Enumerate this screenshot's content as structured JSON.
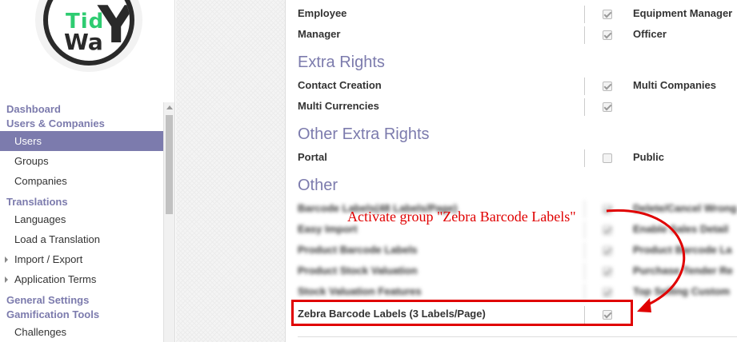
{
  "logo": {
    "text_top": "Tid",
    "text_bottom": "Wa",
    "letter": "Y"
  },
  "sidebar": {
    "sections": [
      {
        "header": "Dashboard"
      },
      {
        "header": "Users & Companies",
        "items": [
          "Users",
          "Groups",
          "Companies"
        ],
        "active": "Users"
      },
      {
        "header": "Translations",
        "items": [
          "Languages",
          "Load a Translation",
          "Import / Export",
          "Application Terms"
        ]
      },
      {
        "header": "General Settings"
      },
      {
        "header": "Gamification Tools",
        "items": [
          "Challenges"
        ]
      }
    ]
  },
  "rights": {
    "rows": [
      {
        "left": "Employee",
        "left_checked": true,
        "right": "Equipment Manager"
      },
      {
        "left": "Manager",
        "left_checked": true,
        "right": "Officer"
      }
    ],
    "extra_title": "Extra Rights",
    "extra_rows": [
      {
        "left": "Contact Creation",
        "left_checked": true,
        "right": "Multi Companies"
      },
      {
        "left": "Multi Currencies",
        "left_checked": true,
        "right": ""
      }
    ],
    "other_extra_title": "Other Extra Rights",
    "other_extra_rows": [
      {
        "left": "Portal",
        "left_checked": false,
        "right": "Public"
      }
    ],
    "other_title": "Other",
    "other_blurred_rows": [
      {
        "left": "Barcode Labels(48 Labels/Page)",
        "right": "Delete/Cancel Wrong"
      },
      {
        "left": "Easy Import",
        "right": "Enable Sales Detail"
      },
      {
        "left": "Product Barcode Labels",
        "right": "Product Barcode La"
      },
      {
        "left": "Product Stock Valuation",
        "right": "Purchase Tender Re"
      },
      {
        "left": "Stock Valuation Features",
        "right": "Top Selling Custom"
      }
    ],
    "zebra_row": {
      "label": "Zebra Barcode Labels (3 Labels/Page)",
      "checked": true
    }
  },
  "annotation": {
    "text": "Activate group \"Zebra Barcode Labels\"",
    "color": "#e00000"
  },
  "colors": {
    "accent": "#7c7bad",
    "annotation": "#e00000"
  }
}
